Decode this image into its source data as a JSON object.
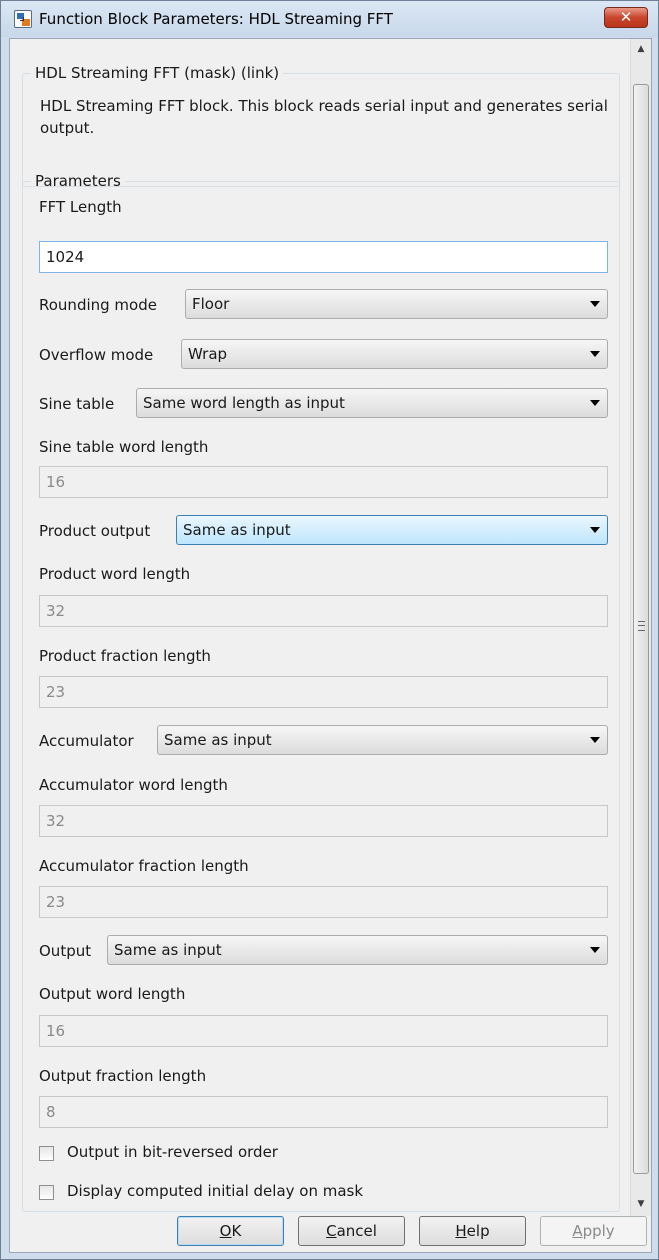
{
  "window": {
    "title": "Function Block Parameters: HDL Streaming FFT",
    "close_glyph": "✕"
  },
  "description": {
    "group_title": "HDL Streaming FFT (mask) (link)",
    "text": "HDL Streaming FFT block. This block reads serial input and generates serial output."
  },
  "parameters": {
    "group_title": "Parameters",
    "fft_length": {
      "label": "FFT Length",
      "value": "1024"
    },
    "rounding_mode": {
      "label": "Rounding mode",
      "value": "Floor"
    },
    "overflow_mode": {
      "label": "Overflow mode",
      "value": "Wrap"
    },
    "sine_table": {
      "label": "Sine table",
      "value": "Same word length as input"
    },
    "sine_table_word_length": {
      "label": "Sine table word length",
      "value": "16"
    },
    "product_output": {
      "label": "Product output",
      "value": "Same as input"
    },
    "product_word_length": {
      "label": "Product word length",
      "value": "32"
    },
    "product_fraction_length": {
      "label": "Product fraction length",
      "value": "23"
    },
    "accumulator": {
      "label": "Accumulator",
      "value": "Same as input"
    },
    "accumulator_word_length": {
      "label": "Accumulator word length",
      "value": "32"
    },
    "accumulator_fraction_length": {
      "label": "Accumulator fraction length",
      "value": "23"
    },
    "output": {
      "label": "Output",
      "value": "Same as input"
    },
    "output_word_length": {
      "label": "Output word length",
      "value": "16"
    },
    "output_fraction_length": {
      "label": "Output fraction length",
      "value": "8"
    },
    "bit_reversed": {
      "label": "Output in bit-reversed order",
      "checked": false
    },
    "display_delay": {
      "label": "Display computed initial delay on mask",
      "checked": false
    }
  },
  "buttons": {
    "ok": {
      "mnemonic": "O",
      "rest": "K"
    },
    "cancel": {
      "mnemonic": "C",
      "rest": "ancel"
    },
    "help": {
      "mnemonic": "H",
      "rest": "elp"
    },
    "apply": {
      "mnemonic": "A",
      "rest": "pply"
    }
  }
}
